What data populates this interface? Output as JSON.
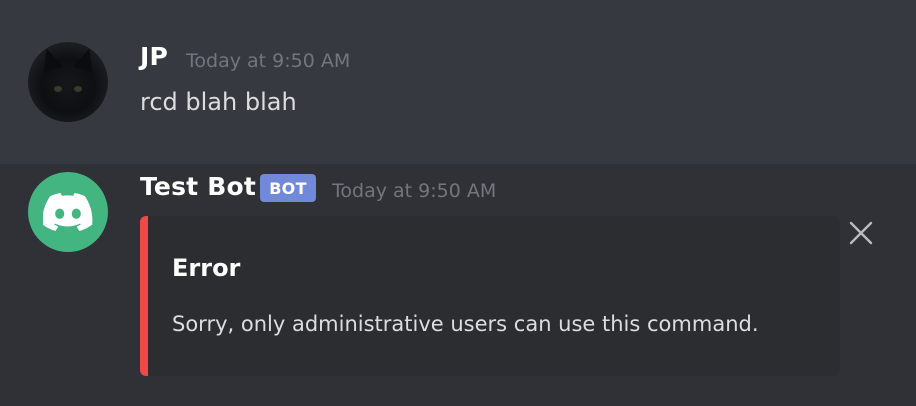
{
  "messages": [
    {
      "username": "JP",
      "timestamp": "Today at 9:50 AM",
      "content": "rcd blah blah"
    },
    {
      "username": "Test Bot",
      "bot_tag": "BOT",
      "timestamp": "Today at 9:50 AM",
      "embed": {
        "title": "Error",
        "description": "Sorry, only administrative users can use this command.",
        "color": "#f04747"
      }
    }
  ],
  "icons": {
    "bot_avatar": "discord-logo-icon",
    "dismiss": "close-icon"
  },
  "colors": {
    "background": "#36393f",
    "bot_message_background": "#2f3136",
    "bot_avatar": "#43b581",
    "bot_tag": "#7289da",
    "embed_accent": "#f04747"
  }
}
